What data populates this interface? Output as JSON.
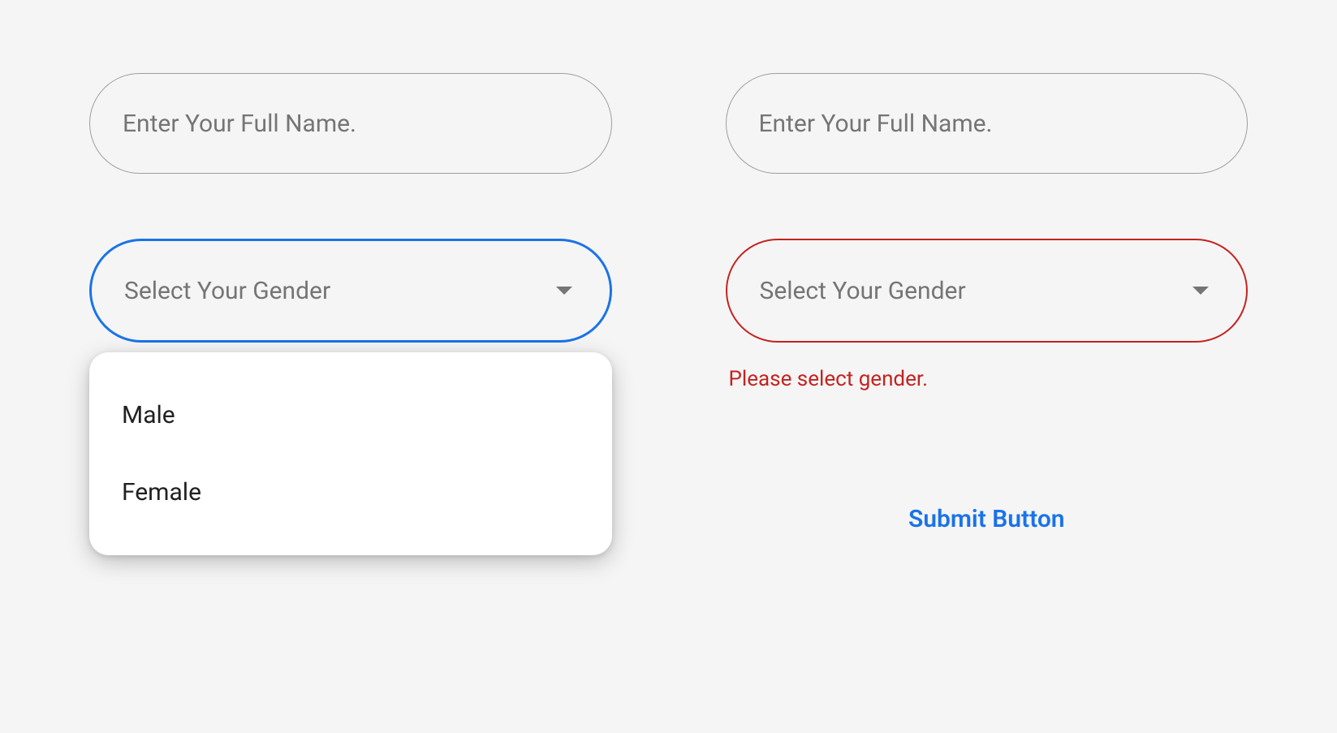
{
  "colors": {
    "focus_border": "#1a73e8",
    "error": "#c5221f",
    "placeholder": "#757575",
    "background": "#f5f5f5"
  },
  "left": {
    "name_placeholder": "Enter Your Full Name.",
    "gender_select_label": "Select Your Gender",
    "gender_options": {
      "0": "Male",
      "1": "Female"
    }
  },
  "right": {
    "name_placeholder": "Enter Your Full Name.",
    "gender_select_label": "Select Your Gender",
    "gender_error_message": "Please select gender.",
    "submit_label": "Submit Button"
  }
}
